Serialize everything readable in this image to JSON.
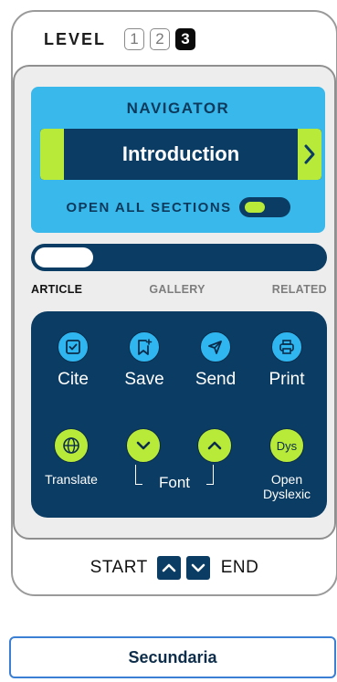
{
  "level": {
    "label": "LEVEL",
    "options": [
      "1",
      "2",
      "3"
    ],
    "selected": "3"
  },
  "navigator": {
    "title": "NAVIGATOR",
    "current_section": "Introduction",
    "open_all_label": "OPEN ALL SECTIONS",
    "open_all_enabled": true
  },
  "progress": {
    "value": 0.15
  },
  "tabs": [
    {
      "label": "ARTICLE",
      "active": true
    },
    {
      "label": "GALLERY",
      "active": false
    },
    {
      "label": "RELATED",
      "active": false
    }
  ],
  "tools": {
    "cite": "Cite",
    "save": "Save",
    "send": "Send",
    "print": "Print",
    "translate": "Translate",
    "font": "Font",
    "open_dyslexic": "Open Dyslexic",
    "dys_badge": "Dys"
  },
  "footer": {
    "start": "START",
    "end": "END"
  },
  "secondary_button": "Secundaria",
  "colors": {
    "navy": "#0b3c63",
    "sky": "#39b8eb",
    "lime": "#b8ea3a",
    "panel": "#ededed",
    "accent_border": "#3b7fd4"
  }
}
